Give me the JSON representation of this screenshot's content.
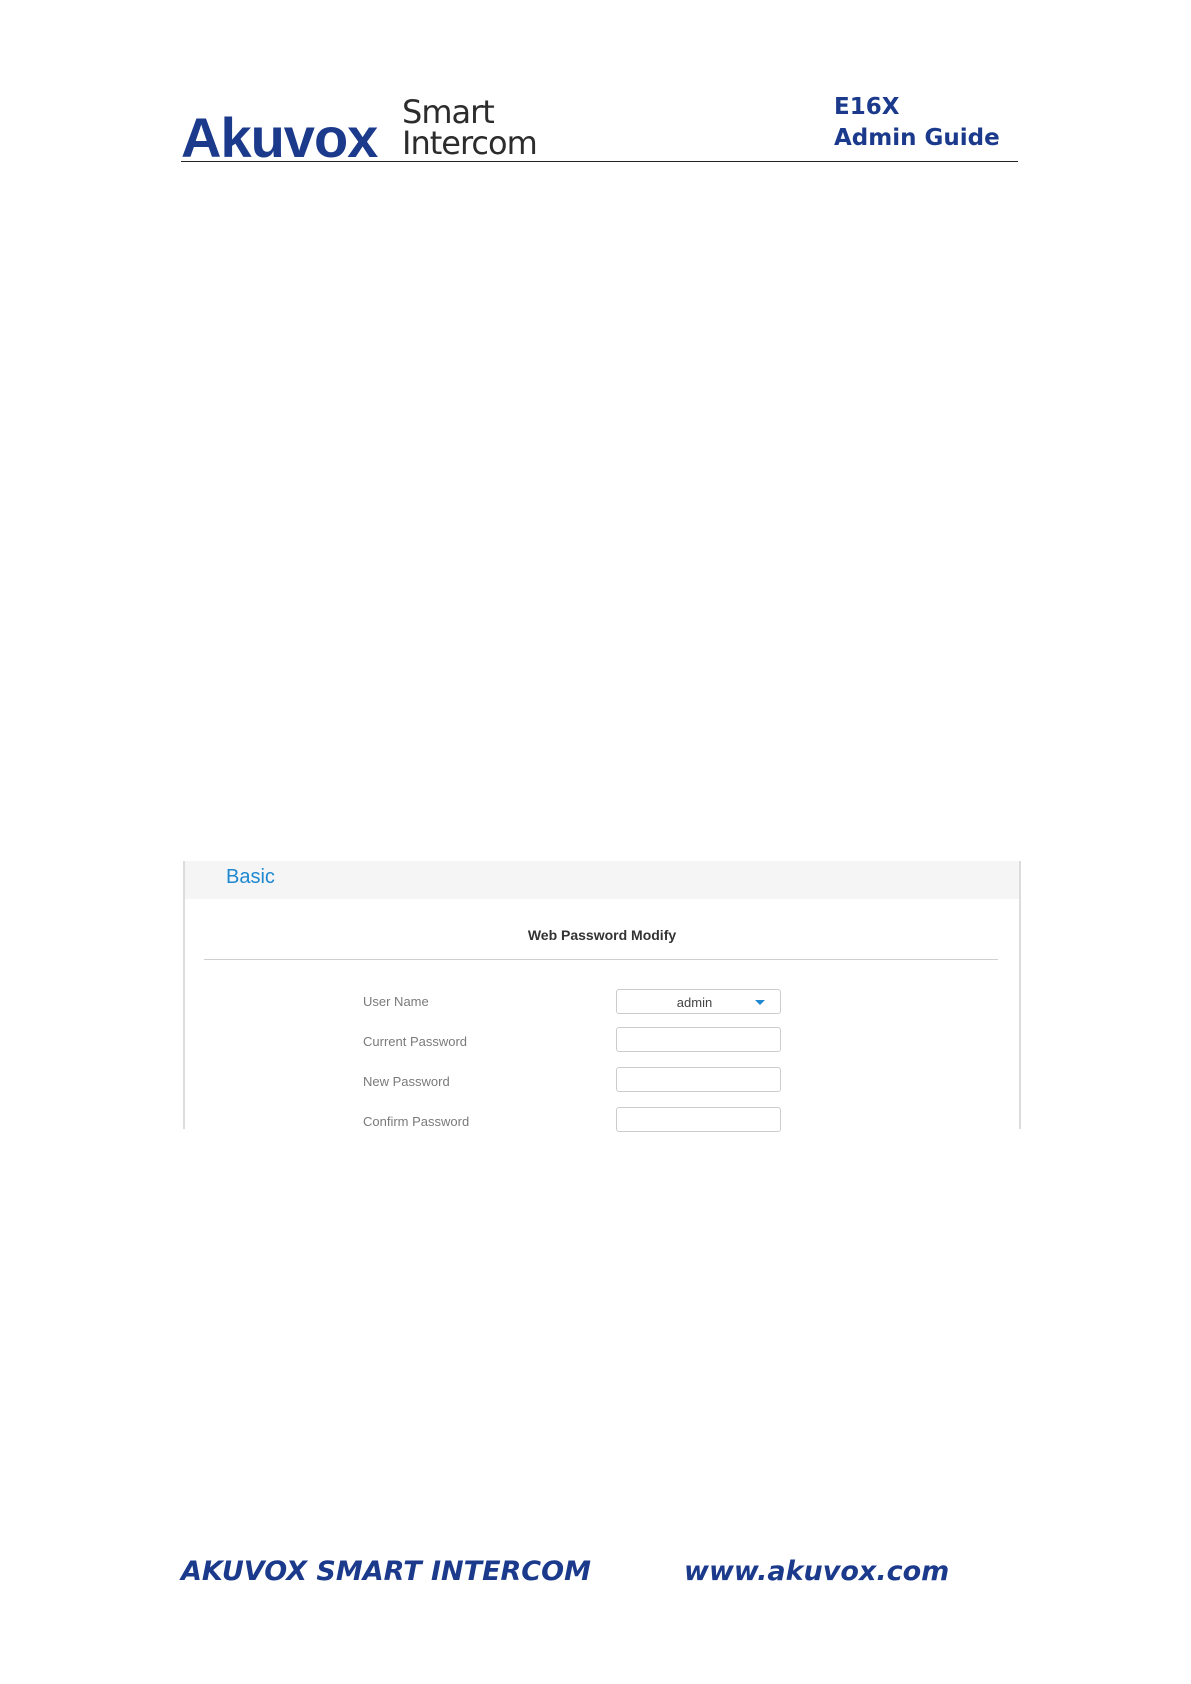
{
  "header": {
    "logo": {
      "brand": "Akuvox",
      "tagline_line1": "Smart",
      "tagline_line2": "Intercom"
    },
    "doc_title_line1": "E16X",
    "doc_title_line2": "Admin Guide"
  },
  "panel": {
    "title": "Basic",
    "section_title": "Web Password Modify",
    "fields": [
      {
        "label": "User Name",
        "value": "admin",
        "type": "select"
      },
      {
        "label": "Current Password",
        "value": "",
        "type": "password"
      },
      {
        "label": "New Password",
        "value": "",
        "type": "password"
      },
      {
        "label": "Confirm Password",
        "value": "",
        "type": "password"
      }
    ]
  },
  "footer": {
    "left": "AKUVOX SMART INTERCOM",
    "right": "www.akuvox.com"
  },
  "colors": {
    "brand_blue": "#1b3a8c",
    "accent_blue": "#1e88d0"
  }
}
